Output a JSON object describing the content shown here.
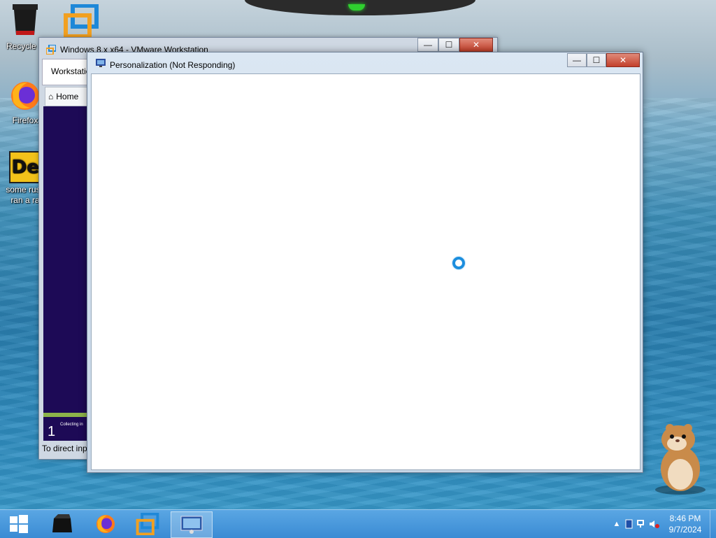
{
  "desktop": {
    "icons": [
      {
        "label": "Recycle B",
        "icon": "recycle-bin-icon"
      },
      {
        "label": "Firefox",
        "icon": "firefox-icon"
      },
      {
        "label": "some russ ran a ra",
        "line1": "some russ",
        "line2": "ran a ra",
        "icon": "document-icon"
      }
    ],
    "vmware_shortcut_icon": "vmware-icon"
  },
  "vmware_window": {
    "title": "Windows 8.x x64 - VMware Workstation",
    "tab_label": "Workstatio",
    "home_label": "Home",
    "setup_step_number": "1",
    "setup_step_text": "Collecting in",
    "status_text": "To direct inp",
    "controls": {
      "minimize": "—",
      "maximize": "☐",
      "close": "✕"
    }
  },
  "personalization_window": {
    "title": "Personalization (Not Responding)",
    "state": "not responding",
    "controls": {
      "minimize": "—",
      "maximize": "☐",
      "close": "✕"
    }
  },
  "taskbar": {
    "start_icon": "windows-start-icon",
    "pinned": [
      {
        "name": "recycle-bin",
        "icon": "black-box-icon"
      },
      {
        "name": "firefox",
        "icon": "firefox-icon"
      },
      {
        "name": "vmware",
        "icon": "vmware-icon"
      },
      {
        "name": "personalization",
        "icon": "control-panel-icon",
        "active": true
      }
    ],
    "tray": {
      "overflow": "▲",
      "time": "8:46 PM",
      "date": "9/7/2024"
    }
  },
  "colors": {
    "taskbar": "#3a8bd4",
    "close_button": "#c3402b",
    "vm_setup_bg": "#1d0a56",
    "spinner": "#1c8ede"
  }
}
